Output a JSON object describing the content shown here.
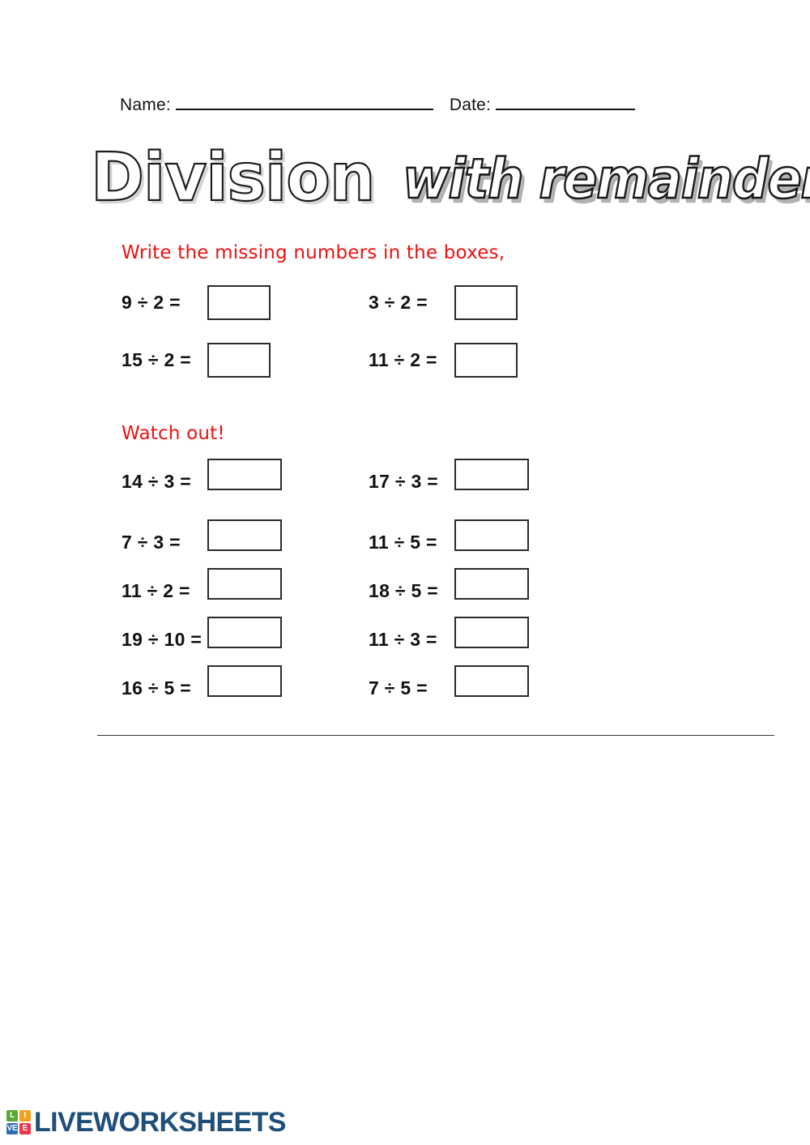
{
  "header": {
    "name_label": "Name:",
    "name_value": "",
    "date_label": "Date:",
    "date_value": ""
  },
  "title": {
    "main": "Division",
    "sub": "with remainders"
  },
  "sections": [
    {
      "heading": "Write the missing numbers in the boxes,",
      "problems": [
        {
          "expr": "9 ÷ 2 =",
          "answer": ""
        },
        {
          "expr": "3 ÷ 2 =",
          "answer": ""
        },
        {
          "expr": "15 ÷ 2 =",
          "answer": ""
        },
        {
          "expr": "11 ÷ 2 =",
          "answer": ""
        }
      ]
    },
    {
      "heading": "Watch out!",
      "problems": [
        {
          "expr": "14 ÷ 3 =",
          "answer": ""
        },
        {
          "expr": "17 ÷ 3 =",
          "answer": ""
        },
        {
          "expr": "7 ÷ 3 =",
          "answer": ""
        },
        {
          "expr": "11 ÷ 5 =",
          "answer": ""
        },
        {
          "expr": "11 ÷ 2 =",
          "answer": ""
        },
        {
          "expr": "18 ÷ 5 =",
          "answer": ""
        },
        {
          "expr": "19 ÷ 10 =",
          "answer": ""
        },
        {
          "expr": "11 ÷ 3 =",
          "answer": ""
        },
        {
          "expr": "16 ÷ 5 =",
          "answer": ""
        },
        {
          "expr": "7 ÷ 5 =",
          "answer": ""
        }
      ]
    }
  ],
  "footer": {
    "logo_cells": [
      "L",
      "I",
      "VE",
      "E"
    ],
    "logo_cell_l": "L",
    "logo_cell_i": "I",
    "logo_cell_v": "VE",
    "logo_cell_e": "E",
    "wordmark": "LIVEWORKSHEETS"
  },
  "colors": {
    "instruction_red": "#ee1111",
    "text_black": "#111111",
    "logo_navy": "#1f4e79",
    "logo_green": "#5aa832",
    "logo_orange": "#f0a01e",
    "logo_blue": "#2f6fae",
    "logo_red": "#e8364a"
  }
}
